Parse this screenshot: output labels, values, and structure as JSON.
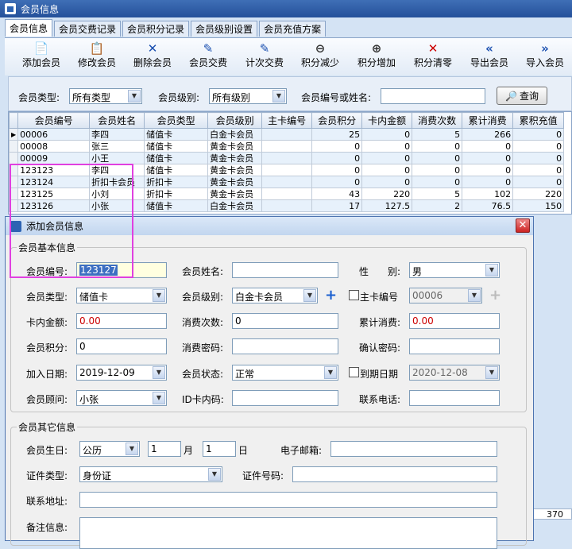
{
  "window": {
    "title": "会员信息"
  },
  "tabs": [
    "会员信息",
    "会员交费记录",
    "会员积分记录",
    "会员级别设置",
    "会员充值方案"
  ],
  "toolbar": [
    {
      "label": "添加会员",
      "icon": "📄",
      "color": "#555"
    },
    {
      "label": "修改会员",
      "icon": "📋",
      "color": "#555"
    },
    {
      "label": "删除会员",
      "icon": "✕",
      "color": "#1a4fb0"
    },
    {
      "label": "会员交费",
      "icon": "✎",
      "color": "#1a4fb0"
    },
    {
      "label": "计次交费",
      "icon": "✎",
      "color": "#1a4fb0"
    },
    {
      "label": "积分减少",
      "icon": "🔍",
      "color": "#333"
    },
    {
      "label": "积分增加",
      "icon": "🔍",
      "color": "#333"
    },
    {
      "label": "积分清零",
      "icon": "✕",
      "color": "#c00"
    },
    {
      "label": "导出会员",
      "icon": "«",
      "color": "#1a4fb0"
    },
    {
      "label": "导入会员",
      "icon": "»",
      "color": "#1a4fb0"
    }
  ],
  "filter": {
    "type_label": "会员类型:",
    "type_value": "所有类型",
    "level_label": "会员级别:",
    "level_value": "所有级别",
    "id_label": "会员编号或姓名:",
    "id_value": "",
    "query_label": "查询"
  },
  "grid": {
    "headers": [
      "会员编号",
      "会员姓名",
      "会员类型",
      "会员级别",
      "主卡编号",
      "会员积分",
      "卡内金额",
      "消费次数",
      "累计消费",
      "累积充值"
    ],
    "rows": [
      [
        "00006",
        "李四",
        "储值卡",
        "白金卡会员",
        "",
        "25",
        "0",
        "5",
        "266",
        "0"
      ],
      [
        "00008",
        "张三",
        "储值卡",
        "黄金卡会员",
        "",
        "0",
        "0",
        "0",
        "0",
        "0"
      ],
      [
        "00009",
        "小王",
        "储值卡",
        "黄金卡会员",
        "",
        "0",
        "0",
        "0",
        "0",
        "0"
      ],
      [
        "123123",
        "李四",
        "储值卡",
        "黄金卡会员",
        "",
        "0",
        "0",
        "0",
        "0",
        "0"
      ],
      [
        "123124",
        "折扣卡会员",
        "折扣卡",
        "黄金卡会员",
        "",
        "0",
        "0",
        "0",
        "0",
        "0"
      ],
      [
        "123125",
        "小刘",
        "折扣卡",
        "黄金卡会员",
        "",
        "43",
        "220",
        "5",
        "102",
        "220"
      ],
      [
        "123126",
        "小张",
        "储值卡",
        "白金卡会员",
        "",
        "17",
        "127.5",
        "2",
        "76.5",
        "150"
      ]
    ],
    "total": "370"
  },
  "dialog": {
    "title": "添加会员信息",
    "basic_title": "会员基本信息",
    "f": {
      "id_label": "会员编号:",
      "id_value": "123127",
      "name_label": "会员姓名:",
      "name_value": "",
      "gender_label": "性　　别:",
      "gender_value": "男",
      "type_label": "会员类型:",
      "type_value": "储值卡",
      "level_label": "会员级别:",
      "level_value": "白金卡会员",
      "main_label": "主卡编号",
      "main_value": "00006",
      "balance_label": "卡内金额:",
      "balance_value": "0.00",
      "count_label": "消费次数:",
      "count_value": "0",
      "total_label": "累计消费:",
      "total_value": "0.00",
      "points_label": "会员积分:",
      "points_value": "0",
      "pwd_label": "消费密码:",
      "pwd_value": "",
      "confirm_label": "确认密码:",
      "confirm_value": "",
      "join_label": "加入日期:",
      "join_value": "2019-12-09",
      "status_label": "会员状态:",
      "status_value": "正常",
      "expire_label": "到期日期",
      "expire_value": "2020-12-08",
      "advisor_label": "会员顾问:",
      "advisor_value": "小张",
      "idcard_label": "ID卡内码:",
      "idcard_value": "",
      "phone_label": "联系电话:",
      "phone_value": ""
    },
    "other_title": "会员其它信息",
    "o": {
      "birth_label": "会员生日:",
      "cal_value": "公历",
      "month_value": "1",
      "month_label": "月",
      "day_value": "1",
      "day_label": "日",
      "email_label": "电子邮箱:",
      "email_value": "",
      "cert_label": "证件类型:",
      "cert_value": "身份证",
      "certno_label": "证件号码:",
      "certno_value": "",
      "addr_label": "联系地址:",
      "addr_value": "",
      "note_label": "备注信息:",
      "note_value": ""
    }
  }
}
